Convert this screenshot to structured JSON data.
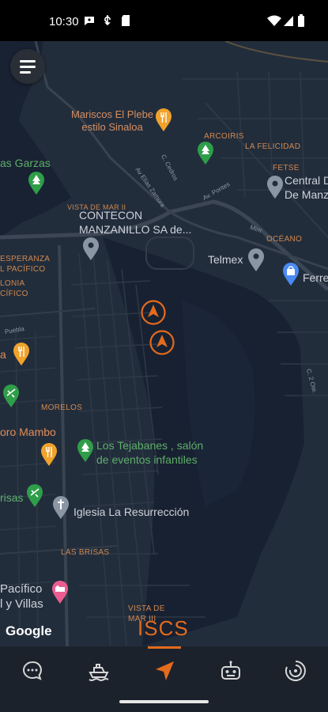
{
  "status_bar": {
    "time": "10:30"
  },
  "map": {
    "pois": {
      "mariscos": "Mariscos El Plebe\nestilo Sinaloa",
      "garzas": "as Garzas",
      "contecon": "CONTECON\nMANZANILLO SA de...",
      "central": "Central D\nDe Manza",
      "telmex": "Telmex",
      "ferre": "Ferre",
      "ca": "a",
      "bro_mambo": "oro Mambo",
      "tejabanes": "Los Tejabanes , salón\nde eventos infantiles",
      "brisas": "risas",
      "iglesia": "Iglesia La Resurrección",
      "pacifico": "Pacífico\nl y Villas"
    },
    "areas": {
      "arcoiris": "ARCOIRIS",
      "la_felicidad": "LA FELICIDAD",
      "fetse": "FETSE",
      "vista_mar_ii": "VISTA DE MAR II",
      "oceano": "OCÉANO",
      "esperanza": "ESPERANZA\nL PACÍFICO",
      "colonia": "LONIA\nCÍFICO",
      "morelos": "MORELOS",
      "las_brisas": "LAS BRISAS",
      "vista_mar_iii": "VISTA DE\nMAR III"
    },
    "streets": {
      "c_cedros": "C. Cedros",
      "av_elias": "Av Elías Zamora",
      "av_pontes": "Av. Pontes",
      "mim": "Mim",
      "puebla": "Puebla",
      "c2": "C. 2 Ote."
    },
    "attribution": "Google",
    "brand": "ISCS"
  },
  "tabs": [
    {
      "name": "chat",
      "icon": "chat-bubble-icon",
      "active": false
    },
    {
      "name": "ship",
      "icon": "ship-icon",
      "active": false
    },
    {
      "name": "navigation",
      "icon": "navigation-arrow-icon",
      "active": true
    },
    {
      "name": "robot",
      "icon": "robot-icon",
      "active": false
    },
    {
      "name": "loading",
      "icon": "spinner-icon",
      "active": false
    }
  ],
  "colors": {
    "accent": "#e36b1d",
    "map_land": "#222d3c",
    "map_water": "#182131",
    "tabbar": "#1c222c"
  }
}
